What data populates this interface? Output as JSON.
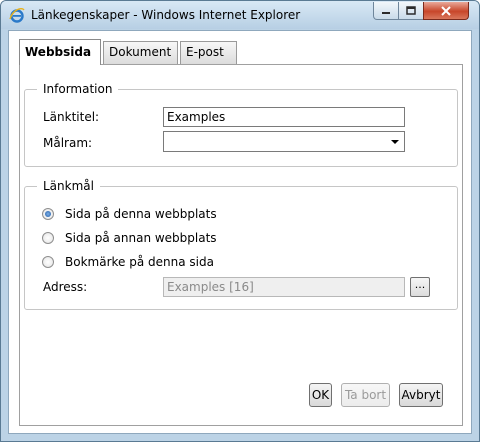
{
  "window": {
    "title": "Länkegenskaper - Windows Internet Explorer"
  },
  "tabs": [
    {
      "label": "Webbsida",
      "active": true
    },
    {
      "label": "Dokument",
      "active": false
    },
    {
      "label": "E-post",
      "active": false
    }
  ],
  "information": {
    "legend": "Information",
    "link_title_label": "Länktitel:",
    "link_title_value": "Examples",
    "target_frame_label": "Målram:",
    "target_frame_value": ""
  },
  "link_target": {
    "legend": "Länkmål",
    "options": [
      {
        "label": "Sida på denna webbplats",
        "checked": true
      },
      {
        "label": "Sida på annan webbplats",
        "checked": false
      },
      {
        "label": "Bokmärke på denna sida",
        "checked": false
      }
    ],
    "address_label": "Adress:",
    "address_value": "Examples [16]",
    "browse_label": "..."
  },
  "buttons": {
    "ok": "OK",
    "remove": "Ta bort",
    "cancel": "Avbryt"
  },
  "colors": {
    "titlebar": "#c8dcec",
    "close_button": "#c8462a",
    "radio_checked": "#1d5aa8"
  }
}
